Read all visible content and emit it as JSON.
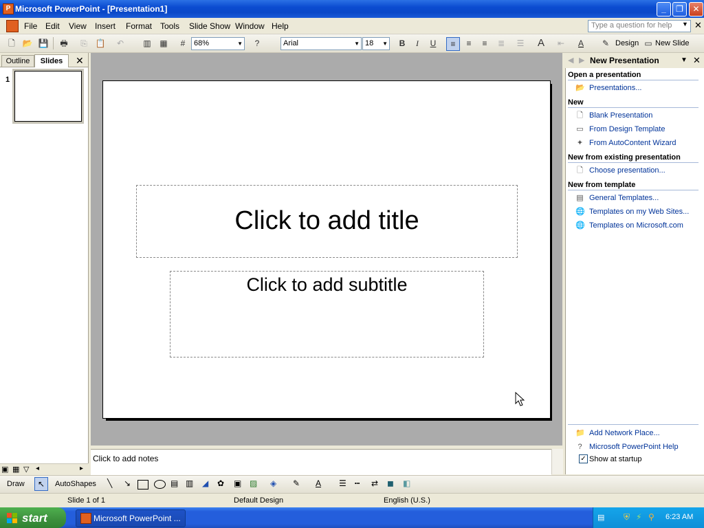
{
  "window": {
    "title": "Microsoft PowerPoint - [Presentation1]",
    "min": "_",
    "max": "❐",
    "close": "✕"
  },
  "menu": {
    "items": [
      "File",
      "Edit",
      "View",
      "Insert",
      "Format",
      "Tools",
      "Slide Show",
      "Window",
      "Help"
    ],
    "help_placeholder": "Type a question for help"
  },
  "toolbar": {
    "zoom": "68%",
    "font": "Arial",
    "size": "18",
    "bold": "B",
    "italic": "I",
    "underline": "U",
    "design": "Design",
    "new_slide": "New Slide"
  },
  "left_pane": {
    "tab_outline": "Outline",
    "tab_slides": "Slides",
    "close": "✕",
    "slide_number": "1"
  },
  "slide": {
    "title": "Click to add title",
    "subtitle": "Click to add subtitle"
  },
  "notes": {
    "placeholder": "Click to add notes"
  },
  "task_pane": {
    "title": "New Presentation",
    "sections": [
      {
        "heading": "Open a presentation",
        "links": [
          "Presentations..."
        ]
      },
      {
        "heading": "New",
        "links": [
          "Blank Presentation",
          "From Design Template",
          "From AutoContent Wizard"
        ]
      },
      {
        "heading": "New from existing presentation",
        "links": [
          "Choose presentation..."
        ]
      },
      {
        "heading": "New from template",
        "links": [
          "General Templates...",
          "Templates on my Web Sites...",
          "Templates on Microsoft.com"
        ]
      }
    ],
    "bottom_links": [
      "Add Network Place...",
      "Microsoft PowerPoint Help"
    ],
    "show_at_startup": "Show at startup",
    "show_at_startup_checked": true
  },
  "draw_toolbar": {
    "draw": "Draw",
    "autoshapes": "AutoShapes"
  },
  "status": {
    "slide": "Slide 1 of 1",
    "design": "Default Design",
    "language": "English (U.S.)"
  },
  "taskbar": {
    "start": "start",
    "task": "Microsoft PowerPoint ...",
    "clock": "6:23 AM"
  },
  "colors": {
    "link": "#003399",
    "titlebar": "#0A48C8",
    "taskbar": "#245EDC",
    "start": "#3C8F3C"
  }
}
